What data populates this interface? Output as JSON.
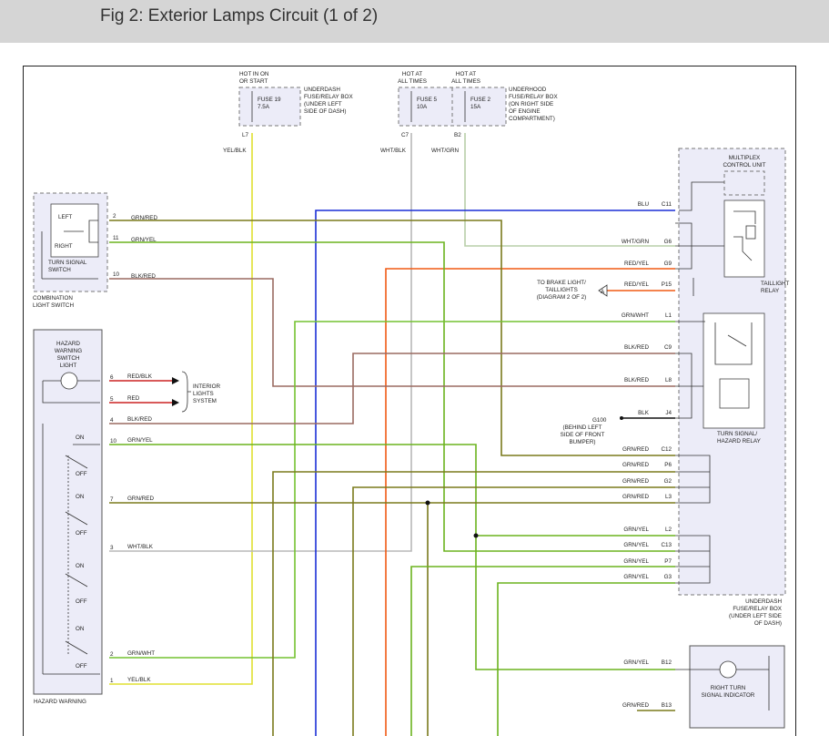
{
  "title": "Fig 2: Exterior Lamps Circuit (1 of 2)",
  "colors": {
    "grn_red": "#7a7a1c",
    "grn_yel": "#6bb31e",
    "grn_wht": "#74c230",
    "blk_red": "#9a6a60",
    "red_blk": "#cc2222",
    "red": "#cc2222",
    "yel_blk": "#e0e030",
    "wht_blk": "#b8b8b8",
    "wht_grn": "#b8cfa8",
    "blu": "#1a2ed6",
    "red_yel": "#f05a14",
    "blk": "#111111",
    "component_fill": "#ececf8",
    "dash": "#777777"
  },
  "fuse_groups": {
    "underdash": {
      "hot_label": [
        "HOT IN ON",
        "OR START"
      ],
      "box_label": [
        "UNDERDASH",
        "FUSE/RELAY BOX",
        "(UNDER LEFT",
        "SIDE OF DASH)"
      ],
      "fuse": [
        "FUSE 19",
        "7.5A"
      ],
      "terminal": "L7",
      "wire": "YEL/BLK"
    },
    "underhood": {
      "hot_label_1": [
        "HOT AT",
        "ALL TIMES"
      ],
      "hot_label_2": [
        "HOT AT",
        "ALL TIMES"
      ],
      "box_label": [
        "UNDERHOOD",
        "FUSE/RELAY BOX",
        "(ON RIGHT SIDE",
        "OF ENGINE",
        "COMPARTMENT)"
      ],
      "fuse_a": [
        "FUSE 5",
        "10A"
      ],
      "fuse_b": [
        "FUSE 2",
        "15A"
      ],
      "terminal_a": "C7",
      "terminal_b": "B2",
      "wire_a": "WHT/BLK",
      "wire_b": "WHT/GRN"
    }
  },
  "turn_signal_switch": {
    "left": "LEFT",
    "right": "RIGHT",
    "name": [
      "TURN SIGNAL",
      "SWITCH"
    ],
    "assembly": [
      "COMBINATION",
      "LIGHT SWITCH"
    ],
    "pins": [
      {
        "pin": "2",
        "wire": "GRN/RED"
      },
      {
        "pin": "11",
        "wire": "GRN/YEL"
      },
      {
        "pin": "10",
        "wire": "BLK/RED"
      }
    ]
  },
  "hazard_switch": {
    "light_label": [
      "HAZARD",
      "WARNING",
      "SWITCH",
      "LIGHT"
    ],
    "bottom_label": "HAZARD WARNING",
    "pins": [
      {
        "pin": "6",
        "wire": "RED/BLK"
      },
      {
        "pin": "5",
        "wire": "RED"
      },
      {
        "pin": "4",
        "wire": "BLK/RED"
      },
      {
        "pin": "10",
        "wire": "GRN/YEL"
      },
      {
        "pin": "7",
        "wire": "GRN/RED"
      },
      {
        "pin": "3",
        "wire": "WHT/BLK"
      },
      {
        "pin": "2",
        "wire": "GRN/WHT"
      },
      {
        "pin": "1",
        "wire": "YEL/BLK"
      }
    ],
    "on": "ON",
    "off": "OFF"
  },
  "interior_lights": [
    "INTERIOR",
    "LIGHTS",
    "SYSTEM"
  ],
  "multiplex": {
    "name": [
      "MULTIPLEX",
      "CONTROL UNIT"
    ],
    "taillight_relay": [
      "TAILLIGHT",
      "RELAY"
    ],
    "turn_relay": [
      "TURN SIGNAL/",
      "HAZARD RELAY"
    ],
    "box_label": [
      "UNDERDASH",
      "FUSE/RELAY BOX",
      "(UNDER LEFT SIDE",
      "OF DASH)"
    ]
  },
  "right_connector": [
    {
      "terminal": "C11",
      "wire": "BLU"
    },
    {
      "terminal": "G6",
      "wire": "WHT/GRN"
    },
    {
      "terminal": "G9",
      "wire": "RED/YEL"
    },
    {
      "terminal": "P15",
      "wire": "RED/YEL"
    },
    {
      "terminal": "L1",
      "wire": "GRN/WHT"
    },
    {
      "terminal": "C9",
      "wire": "BLK/RED"
    },
    {
      "terminal": "L8",
      "wire": "BLK/RED"
    },
    {
      "terminal": "J4",
      "wire": "BLK"
    },
    {
      "terminal": "C12",
      "wire": "GRN/RED"
    },
    {
      "terminal": "P6",
      "wire": "GRN/RED"
    },
    {
      "terminal": "G2",
      "wire": "GRN/RED"
    },
    {
      "terminal": "L3",
      "wire": "GRN/RED"
    },
    {
      "terminal": "L2",
      "wire": "GRN/YEL"
    },
    {
      "terminal": "C13",
      "wire": "GRN/YEL"
    },
    {
      "terminal": "P7",
      "wire": "GRN/YEL"
    },
    {
      "terminal": "G3",
      "wire": "GRN/YEL"
    },
    {
      "terminal": "B12",
      "wire": "GRN/YEL"
    },
    {
      "terminal": "B13",
      "wire": "GRN/RED"
    }
  ],
  "brake_ref": {
    "text": [
      "TO BRAKE LIGHT/",
      "TAILLIGHTS",
      "(DIAGRAM 2 OF 2)"
    ],
    "marker": "A"
  },
  "ground": {
    "name": "G100",
    "text": [
      "(BEHIND LEFT",
      "SIDE OF FRONT",
      "BUMPER)"
    ]
  },
  "right_indicator": [
    "RIGHT TURN",
    "SIGNAL INDICATOR"
  ]
}
